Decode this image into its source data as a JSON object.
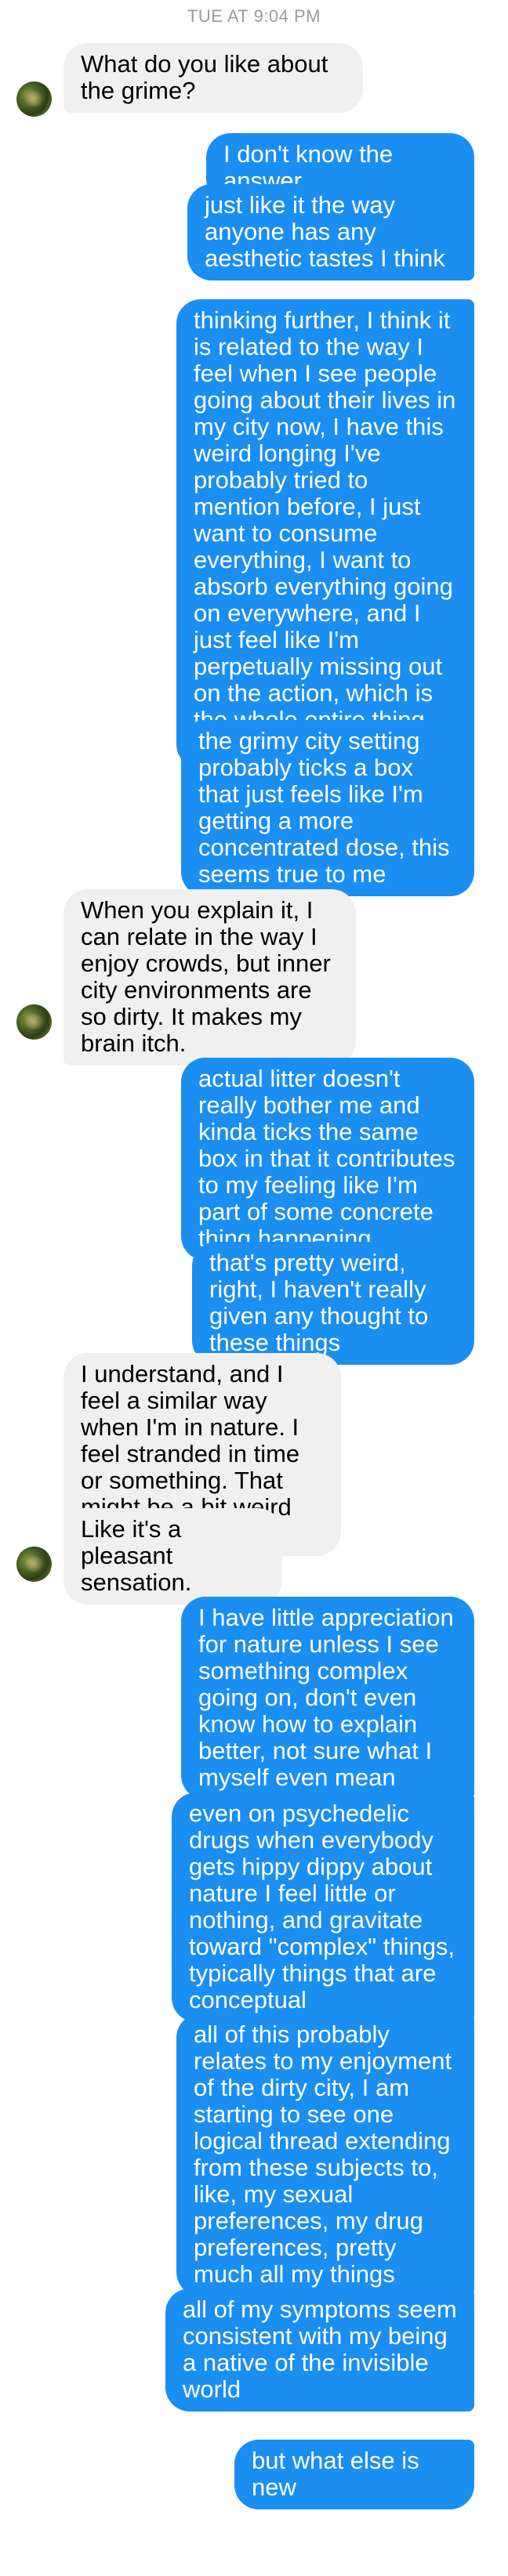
{
  "conversation": {
    "timestamp": "TUE AT 9:04 PM",
    "messages": [
      {
        "sender": "them",
        "text": "What do you like about the grime?"
      },
      {
        "sender": "me",
        "text": "I don't know the answer"
      },
      {
        "sender": "me",
        "text": "just like it the way anyone has any aesthetic tastes I think"
      },
      {
        "sender": "me",
        "text": "thinking further, I think it is related to the way I feel when I see people going about their lives in my city now, I have this weird longing I've probably tried to mention before, I just want to consume everything, I want to absorb everything going on everywhere, and I just feel like I'm perpetually missing out on the action, which is the whole entire thing together"
      },
      {
        "sender": "me",
        "text": "the grimy city setting probably ticks a box that just feels like I'm getting a more concentrated dose, this seems true to me"
      },
      {
        "sender": "them",
        "text": "When you explain it, I can relate in the way I enjoy crowds, but inner city environments are so dirty. It makes my brain itch."
      },
      {
        "sender": "me",
        "text": "actual litter doesn't really bother me and kinda ticks the same box in that it contributes to my feeling like I'm part of some concrete thing happening"
      },
      {
        "sender": "me",
        "text": "that's pretty weird, right, I haven't really given any thought to these things"
      },
      {
        "sender": "them",
        "text": "I understand, and I feel a similar way when I'm in nature. I feel stranded in time or something. That might be a bit weird too."
      },
      {
        "sender": "them",
        "text": "Like it's a pleasant sensation."
      },
      {
        "sender": "me",
        "text": "I have little appreciation for nature unless I see something complex going on, don't even know how to explain better, not sure what I myself even mean"
      },
      {
        "sender": "me",
        "text": "even on psychedelic drugs when everybody gets hippy dippy about nature I feel little or nothing, and gravitate toward \"complex\" things, typically things that are conceptual"
      },
      {
        "sender": "me",
        "text": "all of this probably relates to my enjoyment of the dirty city, I am starting to see one logical thread extending from these subjects to, like, my sexual preferences, my drug preferences, pretty much all my things"
      },
      {
        "sender": "me",
        "text": "all of my symptoms seem consistent with my being a native of the invisible world"
      },
      {
        "sender": "me",
        "text": "but what else is new"
      }
    ]
  }
}
